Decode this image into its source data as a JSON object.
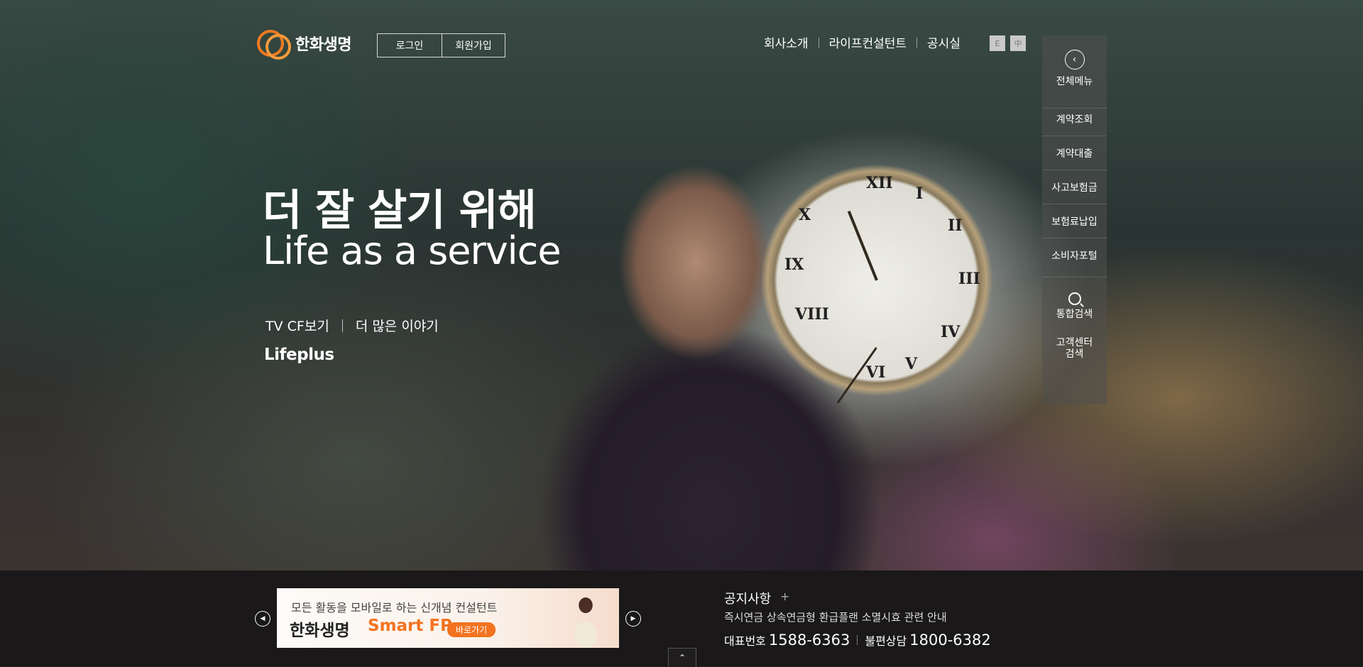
{
  "header": {
    "logo_text": "한화생명",
    "login_label": "로그인",
    "join_label": "회원가입",
    "nav": [
      "회사소개",
      "라이프컨설턴트",
      "공시실"
    ],
    "lang_en": "E",
    "lang_cn": "中"
  },
  "quick_menu": {
    "all_menu_label": "전체메뉴",
    "items": [
      "계약조회",
      "계약대출",
      "사고보험금",
      "보험료납입",
      "소비자포털"
    ],
    "search_label": "통합검색",
    "center_search_label": "고객센터\n검색"
  },
  "hero": {
    "headline_ko": "더 잘 살기 위해",
    "headline_en": "Life as a service",
    "link_tvcf": "TV CF보기",
    "link_story": "더 많은 이야기",
    "lifeplus": "Lifeplus"
  },
  "bottom": {
    "banner_line1": "모든 활동을 모바일로 하는 신개념 컨설턴트",
    "banner_brand": "한화생명",
    "banner_product": "Smart FP",
    "banner_go": "바로가기",
    "notice_title": "공지사항",
    "notice_more": "+",
    "notice_text": "즉시연금 상속연금형 환급플랜 소멸시효 관련 안내",
    "phone_main_label": "대표번호",
    "phone_main": "1588-6363",
    "phone_complaint_label": "불편상담",
    "phone_complaint": "1800-6382"
  },
  "colors": {
    "brand_orange": "#f37321"
  },
  "icons": {
    "prev": "chevron-left-icon",
    "next": "chevron-right-icon",
    "up": "chevron-up-icon",
    "search": "search-icon",
    "menu_back": "circle-arrow-left-icon"
  }
}
